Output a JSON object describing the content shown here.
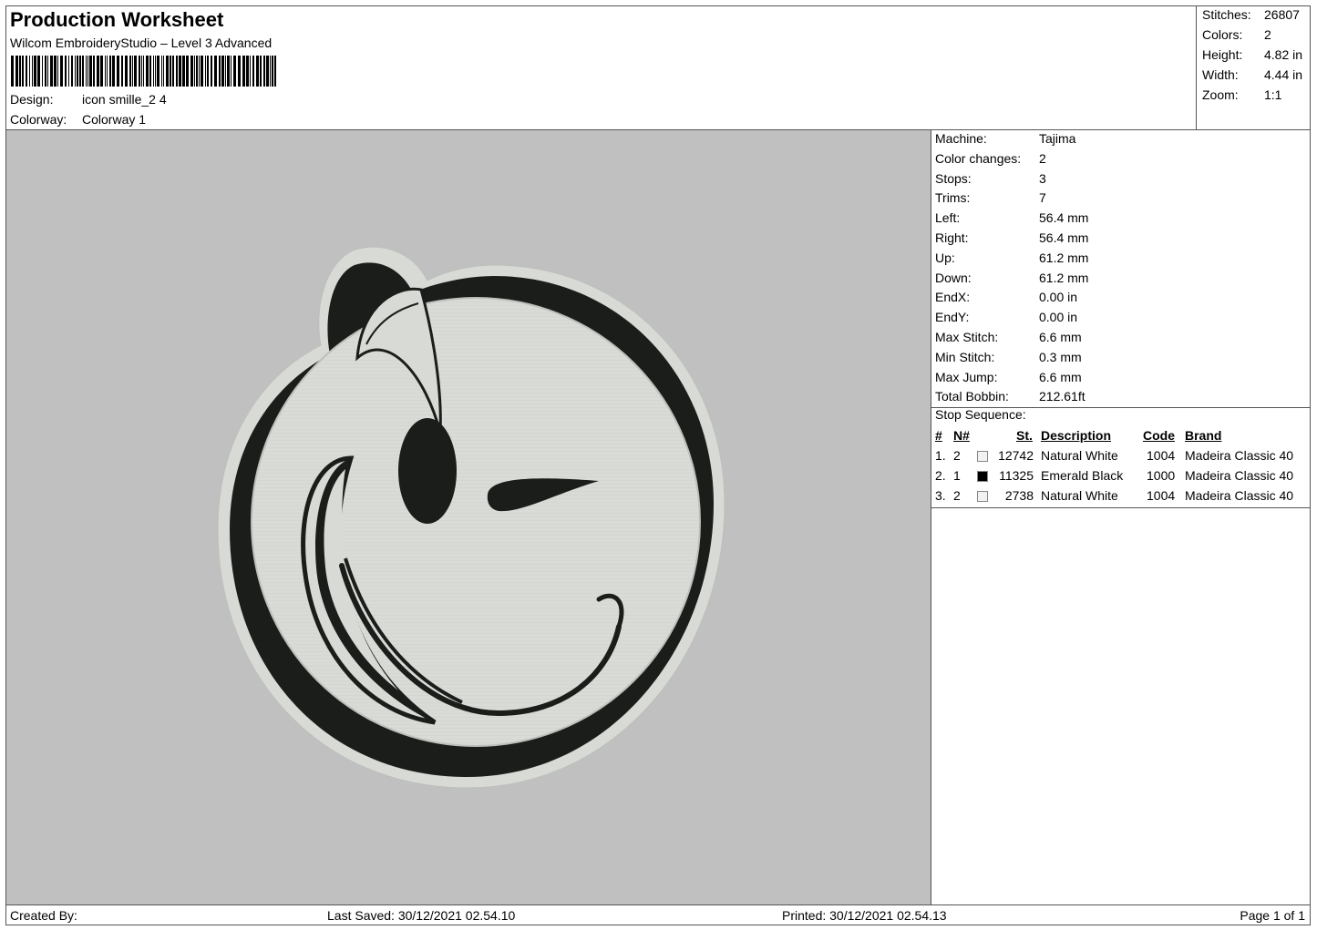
{
  "header": {
    "title": "Production Worksheet",
    "subtitle": "Wilcom EmbroideryStudio – Level 3 Advanced",
    "design_label": "Design:",
    "design_value": "icon smille_2 4",
    "colorway_label": "Colorway:",
    "colorway_value": "Colorway 1"
  },
  "stats": {
    "stitches_label": "Stitches:",
    "stitches_value": "26807",
    "colors_label": "Colors:",
    "colors_value": "2",
    "height_label": "Height:",
    "height_value": "4.82 in",
    "width_label": "Width:",
    "width_value": "4.44 in",
    "zoom_label": "Zoom:",
    "zoom_value": "1:1"
  },
  "machine_info": [
    {
      "label": "Machine:",
      "value": "Tajima"
    },
    {
      "label": "Color changes:",
      "value": "2"
    },
    {
      "label": "Stops:",
      "value": "3"
    },
    {
      "label": "Trims:",
      "value": "7"
    },
    {
      "label": "Left:",
      "value": "56.4 mm"
    },
    {
      "label": "Right:",
      "value": "56.4 mm"
    },
    {
      "label": "Up:",
      "value": "61.2 mm"
    },
    {
      "label": "Down:",
      "value": "61.2 mm"
    },
    {
      "label": "EndX:",
      "value": "0.00 in"
    },
    {
      "label": "EndY:",
      "value": "0.00 in"
    },
    {
      "label": "Max Stitch:",
      "value": "6.6 mm"
    },
    {
      "label": "Min Stitch:",
      "value": "0.3 mm"
    },
    {
      "label": "Max Jump:",
      "value": "6.6 mm"
    },
    {
      "label": "Total Bobbin:",
      "value": "212.61ft"
    }
  ],
  "stop_sequence": {
    "title": "Stop Sequence:",
    "headers": {
      "num": "#",
      "n": "N#",
      "st": "St.",
      "description": "Description",
      "code": "Code",
      "brand": "Brand"
    },
    "rows": [
      {
        "num": "1.",
        "n": "2",
        "color": "#f2f2f2",
        "st": "12742",
        "description": "Natural White",
        "code": "1004",
        "brand": "Madeira Classic 40"
      },
      {
        "num": "2.",
        "n": "1",
        "color": "#000000",
        "st": "11325",
        "description": "Emerald Black",
        "code": "1000",
        "brand": "Madeira Classic 40"
      },
      {
        "num": "3.",
        "n": "2",
        "color": "#f2f2f2",
        "st": "2738",
        "description": "Natural White",
        "code": "1004",
        "brand": "Madeira Classic 40"
      }
    ]
  },
  "footer": {
    "created_by": "Created By:",
    "last_saved": "Last Saved: 30/12/2021 02.54.10",
    "printed": "Printed: 30/12/2021 02.54.13",
    "page": "Page 1 of 1"
  },
  "colors": {
    "preview_bg": "#c0c0c0",
    "thread_white": "#d8dad6",
    "thread_black": "#1b1d1a"
  }
}
